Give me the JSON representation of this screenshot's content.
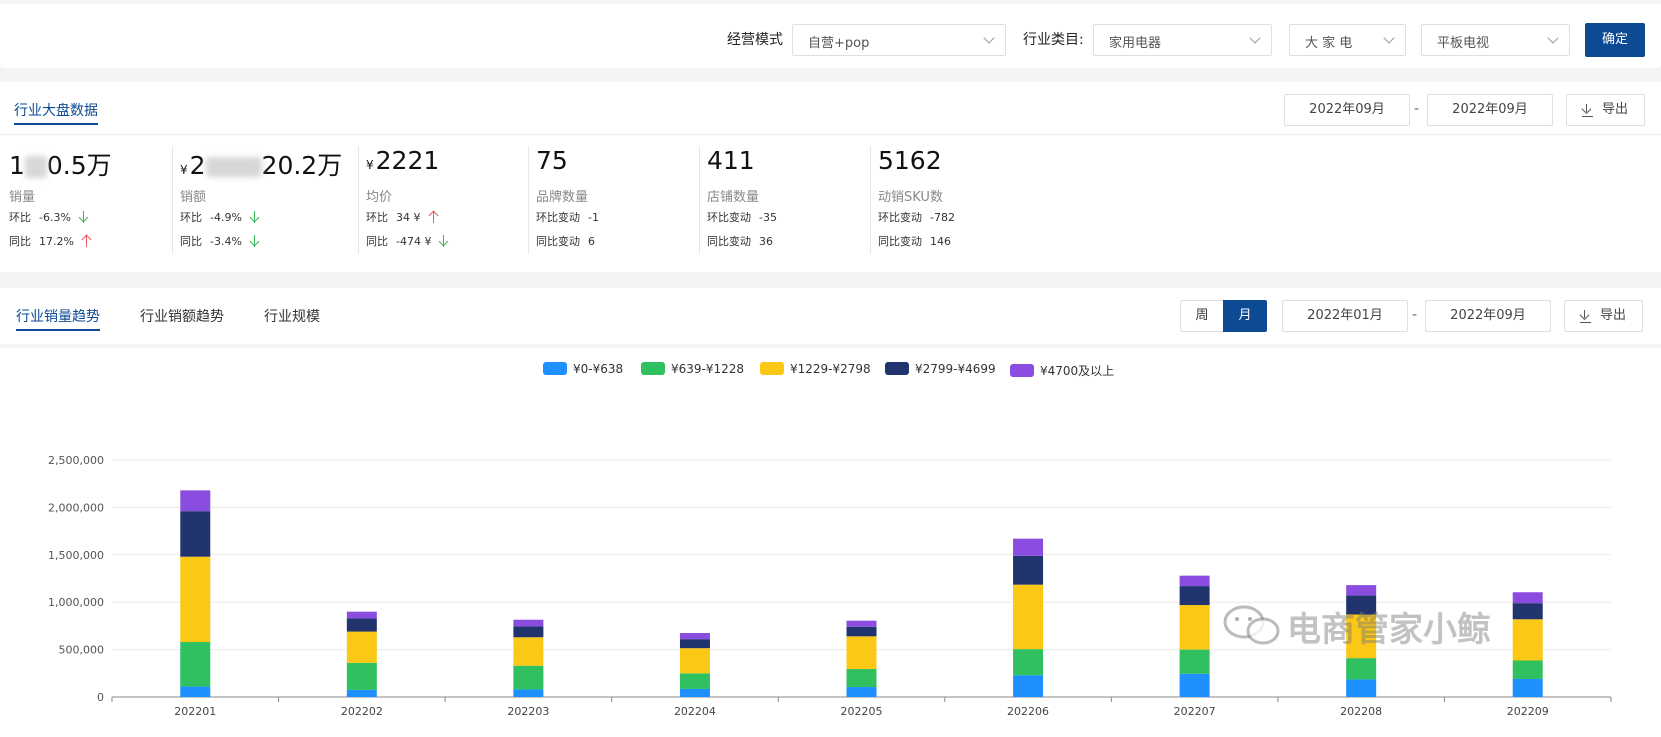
{
  "filters": {
    "mode_label": "经营模式",
    "mode_value": "自营+pop",
    "category_label": "行业类目:",
    "category_l1": "家用电器",
    "category_l2": "大 家 电",
    "category_l3": "平板电视",
    "confirm_label": "确定"
  },
  "overview": {
    "tab_label": "行业大盘数据",
    "date_from": "2022年09月",
    "date_sep": "-",
    "date_to": "2022年09月",
    "export_label": "导出",
    "metrics": [
      {
        "value_visible": "0.5万",
        "name": "销量",
        "row1_label": "环比",
        "row1_value": "-6.3%",
        "row1_dir": "down",
        "row2_label": "同比",
        "row2_value": "17.2%",
        "row2_dir": "up"
      },
      {
        "currency": "¥",
        "value_prefix": "2",
        "value_visible": "20.2万",
        "name": "销额",
        "row1_label": "环比",
        "row1_value": "-4.9%",
        "row1_dir": "down",
        "row2_label": "同比",
        "row2_value": "-3.4%",
        "row2_dir": "down"
      },
      {
        "currency": "¥",
        "value_visible": "2221",
        "name": "均价",
        "row1_label": "环比",
        "row1_value": "34 ¥",
        "row1_dir": "up",
        "row2_label": "同比",
        "row2_value": "-474 ¥",
        "row2_dir": "down"
      },
      {
        "value_visible": "75",
        "name": "品牌数量",
        "row1_label": "环比变动",
        "row1_value": "-1",
        "row2_label": "同比变动",
        "row2_value": "6"
      },
      {
        "value_visible": "411",
        "name": "店铺数量",
        "row1_label": "环比变动",
        "row1_value": "-35",
        "row2_label": "同比变动",
        "row2_value": "36"
      },
      {
        "value_visible": "5162",
        "name": "动销SKU数",
        "row1_label": "环比变动",
        "row1_value": "-782",
        "row2_label": "同比变动",
        "row2_value": "146"
      }
    ]
  },
  "trend": {
    "tabs": [
      "行业销量趋势",
      "行业销额趋势",
      "行业规模"
    ],
    "period_week": "周",
    "period_month": "月",
    "date_from": "2022年01月",
    "date_sep": "-",
    "date_to": "2022年09月",
    "export_label": "导出"
  },
  "watermark": "电商管家小鲸",
  "colors": {
    "accent": "#0c4a94",
    "up": "#e55a5a",
    "down": "#3cb85c"
  },
  "chart_data": {
    "type": "bar",
    "stacked": true,
    "categories": [
      "202201",
      "202202",
      "202203",
      "202204",
      "202205",
      "202206",
      "202207",
      "202208",
      "202209"
    ],
    "ylim": [
      0,
      2500000
    ],
    "yticks": [
      0,
      500000,
      1000000,
      1500000,
      2000000,
      2500000
    ],
    "ytick_labels": [
      "0",
      "500,000",
      "1,000,000",
      "1,500,000",
      "2,000,000",
      "2,500,000"
    ],
    "legend_position": "top-center",
    "grid": true,
    "series": [
      {
        "name": "¥0-¥638",
        "color": "#1e90ff",
        "values": [
          110000,
          75000,
          80000,
          85000,
          105000,
          230000,
          245000,
          185000,
          190000
        ]
      },
      {
        "name": "¥639-¥1228",
        "color": "#30c060",
        "values": [
          470000,
          285000,
          250000,
          165000,
          190000,
          275000,
          255000,
          225000,
          195000
        ]
      },
      {
        "name": "¥1229-¥2798",
        "color": "#fbc816",
        "values": [
          900000,
          330000,
          300000,
          265000,
          345000,
          680000,
          470000,
          460000,
          435000
        ]
      },
      {
        "name": "¥2799-¥4699",
        "color": "#21346e",
        "values": [
          480000,
          140000,
          115000,
          95000,
          100000,
          305000,
          200000,
          200000,
          170000
        ]
      },
      {
        "name": "¥4700及以上",
        "color": "#8b4de0",
        "values": [
          220000,
          70000,
          70000,
          65000,
          65000,
          180000,
          110000,
          110000,
          115000
        ]
      }
    ]
  }
}
